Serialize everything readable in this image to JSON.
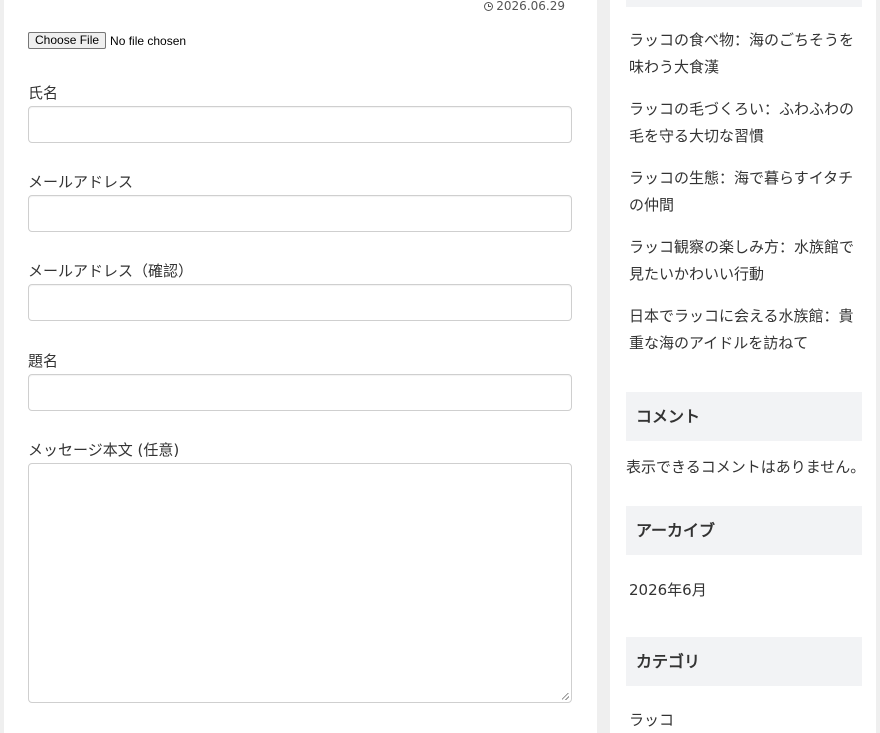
{
  "post": {
    "date": "2026.06.29"
  },
  "file_input": {
    "button_label": "Choose File",
    "status": "No file chosen"
  },
  "form": {
    "name_label": "氏名",
    "email_label": "メールアドレス",
    "email_confirm_label": "メールアドレス（確認）",
    "subject_label": "題名",
    "message_label": "メッセージ本文 (任意)"
  },
  "sidebar": {
    "recent_posts": [
      "ラッコの食べ物：海のごちそうを味わう大食漢",
      "ラッコの毛づくろい：ふわふわの毛を守る大切な習慣",
      "ラッコの生態：海で暮らすイタチの仲間",
      "ラッコ観察の楽しみ方：水族館で見たいかわいい行動",
      "日本でラッコに会える水族館：貴重な海のアイドルを訪ねて"
    ],
    "comments_heading": "コメント",
    "comments_empty": "表示できるコメントはありません。",
    "archive_heading": "アーカイブ",
    "archive_items": [
      "2026年6月"
    ],
    "category_heading": "カテゴリ",
    "category_items": [
      "ラッコ"
    ]
  }
}
